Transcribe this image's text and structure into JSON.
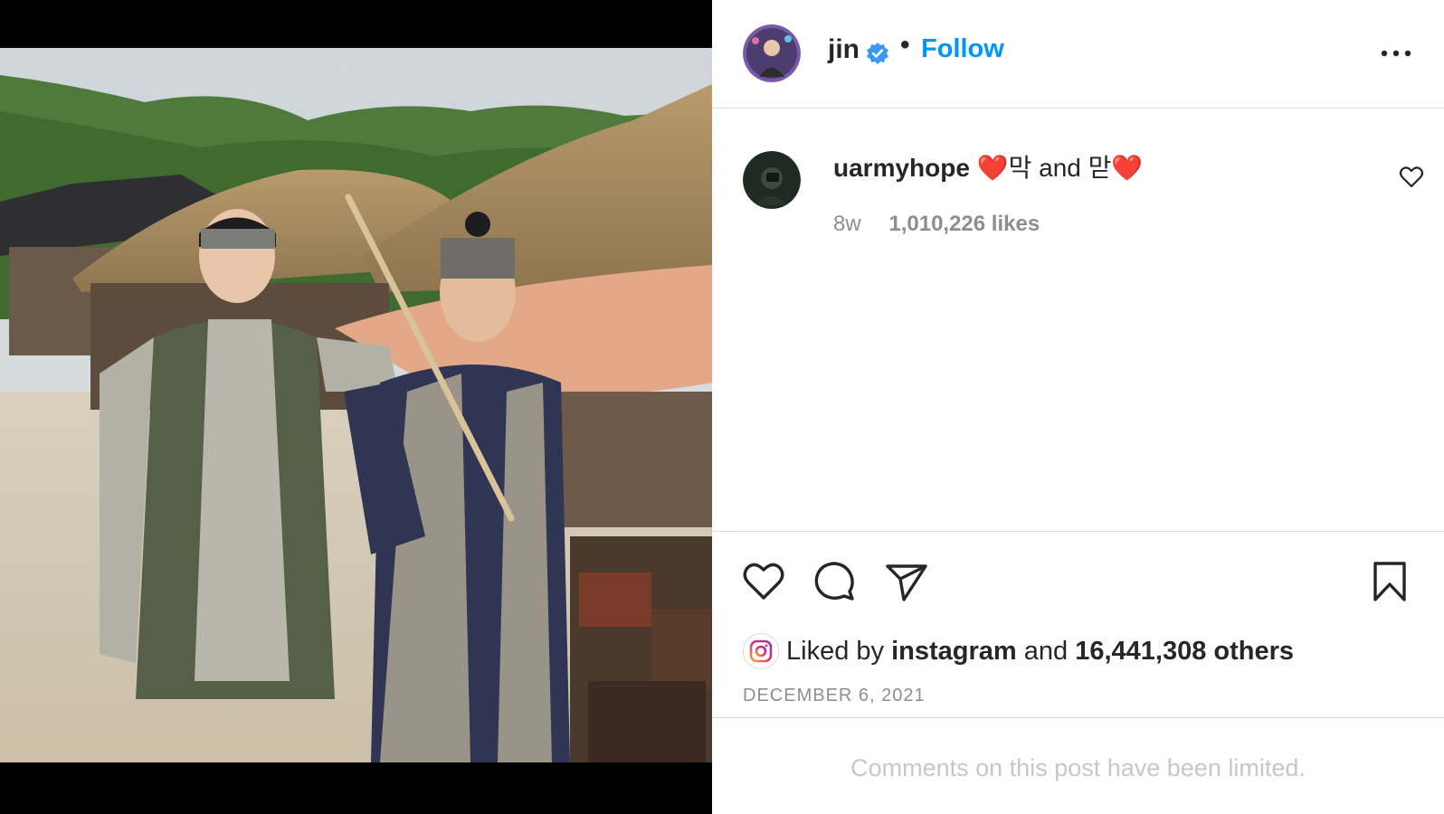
{
  "post": {
    "author": "jin",
    "separator": "•",
    "follow_label": "Follow",
    "verified": true
  },
  "caption": {
    "username": "uarmyhope",
    "text": "❤️막 and 맏❤️",
    "age": "8w",
    "likes": "1,010,226 likes"
  },
  "engagement": {
    "liked_by_prefix": "Liked by",
    "liked_by_user": "instagram",
    "and_text": "and",
    "others": "16,441,308 others",
    "date": "DECEMBER 6, 2021"
  },
  "comments": {
    "limited_notice": "Comments on this post have been limited."
  },
  "colors": {
    "accent": "#0095f6",
    "verified": "#3897f0",
    "divider": "#dbdbdb",
    "muted": "#8e8e8e"
  },
  "icons": {
    "like": "heart-icon",
    "comment": "comment-icon",
    "share": "send-icon",
    "save": "bookmark-icon",
    "more": "more-options-icon"
  }
}
